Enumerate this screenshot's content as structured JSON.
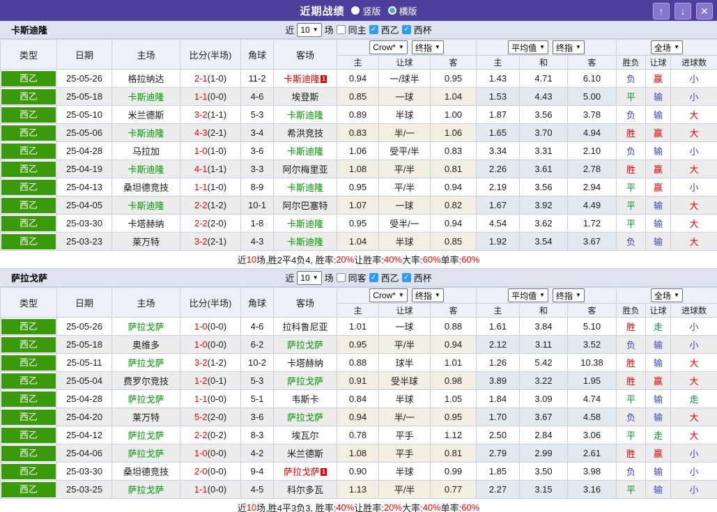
{
  "titlebar": {
    "title": "近期战绩",
    "radio_vertical": "竖版",
    "radio_horizontal": "横版",
    "selected_radio": "竖版",
    "up_icon": "↑",
    "down_icon": "↓",
    "close_icon": "✕"
  },
  "filter_labels": {
    "near": "近",
    "games": "场"
  },
  "table_header": {
    "type": "类型",
    "date": "日期",
    "home": "主场",
    "score": "比分(半场)",
    "corner": "角球",
    "away": "客场",
    "odds_source": "Crow*",
    "odds_final": "终指",
    "avg": "平均值",
    "avg_final": "终指",
    "fulltime": "全场",
    "sub_home": "主",
    "sub_handicap": "让球",
    "sub_away": "客",
    "sub_avg_home": "主",
    "sub_avg_draw": "和",
    "sub_avg_away": "客",
    "sub_result": "胜负",
    "sub_handicap_result": "让球",
    "sub_goals": "进球数"
  },
  "result_colors": {
    "r": "#e60000",
    "g": "#009933",
    "b": "#3b44c8"
  },
  "colors": {
    "titlebar_purple": "#4f3f9c",
    "titlebar_button": "#8577cd",
    "league_green": "#3a9a0c",
    "team_green": "#009900",
    "team_red": "#e60000",
    "score_red": "#ff0000",
    "filter_bg": "#dde4ef",
    "header_bg": "#ecf0f7",
    "odds_col_bg": "#fdf8ee",
    "avg_col_bg": "#e9f4f9",
    "checkbox_blue": "#2e9cf5"
  },
  "sections": [
    {
      "team": "卡斯迪隆",
      "filter": {
        "count": "10",
        "same_label": "同主",
        "same_checked": false,
        "league_label": "西乙",
        "league_checked": true,
        "cup_label": "西杯",
        "cup_checked": true
      },
      "rows": [
        {
          "lg": "西乙",
          "date": "25-05-26",
          "home": "格拉纳达",
          "homeType": "other",
          "away": "卡斯迪隆",
          "awayType": "red",
          "awayBadge": "1",
          "ft": "2-1",
          "ht": "(1-0)",
          "corner": "11-2",
          "oddsH": "0.94",
          "handicap": "一/球半",
          "oddsA": "0.95",
          "avgH": "1.43",
          "avgD": "4.71",
          "avgA": "6.10",
          "res": {
            "t": "负",
            "c": "b"
          },
          "hres": {
            "t": "赢",
            "c": "r"
          },
          "goals": {
            "t": "小",
            "c": "b"
          }
        },
        {
          "lg": "西乙",
          "date": "25-05-18",
          "home": "卡斯迪隆",
          "homeType": "self",
          "away": "埃登斯",
          "awayType": "other",
          "ft": "1-1",
          "ht": "(0-0)",
          "corner": "4-6",
          "oddsH": "0.85",
          "handicap": "一球",
          "oddsA": "1.04",
          "avgH": "1.53",
          "avgD": "4.43",
          "avgA": "5.00",
          "res": {
            "t": "平",
            "c": "g"
          },
          "hres": {
            "t": "输",
            "c": "b"
          },
          "goals": {
            "t": "小",
            "c": "b"
          }
        },
        {
          "lg": "西乙",
          "date": "25-05-10",
          "home": "米兰德斯",
          "homeType": "other",
          "away": "卡斯迪隆",
          "awayType": "self",
          "ft": "3-2",
          "ht": "(1-1)",
          "corner": "5-3",
          "oddsH": "0.89",
          "handicap": "半球",
          "oddsA": "1.00",
          "avgH": "1.87",
          "avgD": "3.56",
          "avgA": "3.78",
          "res": {
            "t": "负",
            "c": "b"
          },
          "hres": {
            "t": "输",
            "c": "b"
          },
          "goals": {
            "t": "大",
            "c": "r"
          }
        },
        {
          "lg": "西乙",
          "date": "25-05-06",
          "home": "卡斯迪隆",
          "homeType": "self",
          "away": "希洪竞技",
          "awayType": "other",
          "ft": "4-3",
          "ht": "(2-1)",
          "corner": "3-4",
          "oddsH": "0.83",
          "handicap": "半/一",
          "oddsA": "1.06",
          "avgH": "1.65",
          "avgD": "3.70",
          "avgA": "4.94",
          "res": {
            "t": "胜",
            "c": "r"
          },
          "hres": {
            "t": "赢",
            "c": "r"
          },
          "goals": {
            "t": "大",
            "c": "r"
          }
        },
        {
          "lg": "西乙",
          "date": "25-04-28",
          "home": "马拉加",
          "homeType": "other",
          "away": "卡斯迪隆",
          "awayType": "self",
          "ft": "1-0",
          "ht": "(1-0)",
          "corner": "3-6",
          "oddsH": "1.06",
          "handicap": "受平/半",
          "oddsA": "0.83",
          "avgH": "3.34",
          "avgD": "3.31",
          "avgA": "2.10",
          "res": {
            "t": "负",
            "c": "b"
          },
          "hres": {
            "t": "输",
            "c": "b"
          },
          "goals": {
            "t": "小",
            "c": "b"
          }
        },
        {
          "lg": "西乙",
          "date": "25-04-19",
          "home": "卡斯迪隆",
          "homeType": "self",
          "away": "阿尔梅里亚",
          "awayType": "other",
          "ft": "4-1",
          "ht": "(1-1)",
          "corner": "3-3",
          "oddsH": "1.08",
          "handicap": "平/半",
          "oddsA": "0.81",
          "avgH": "2.26",
          "avgD": "3.61",
          "avgA": "2.78",
          "res": {
            "t": "胜",
            "c": "r"
          },
          "hres": {
            "t": "赢",
            "c": "r"
          },
          "goals": {
            "t": "大",
            "c": "r"
          }
        },
        {
          "lg": "西乙",
          "date": "25-04-13",
          "home": "桑坦德竞技",
          "homeType": "other",
          "away": "卡斯迪隆",
          "awayType": "self",
          "ft": "1-1",
          "ht": "(1-0)",
          "corner": "8-9",
          "oddsH": "0.95",
          "handicap": "平/半",
          "oddsA": "0.94",
          "avgH": "2.19",
          "avgD": "3.56",
          "avgA": "2.94",
          "res": {
            "t": "平",
            "c": "g"
          },
          "hres": {
            "t": "赢",
            "c": "r"
          },
          "goals": {
            "t": "小",
            "c": "b"
          }
        },
        {
          "lg": "西乙",
          "date": "25-04-05",
          "home": "卡斯迪隆",
          "homeType": "self",
          "away": "阿尔巴塞特",
          "awayType": "other",
          "ft": "2-2",
          "ht": "(1-2)",
          "corner": "10-1",
          "oddsH": "1.07",
          "handicap": "一球",
          "oddsA": "0.82",
          "avgH": "1.67",
          "avgD": "3.92",
          "avgA": "4.49",
          "res": {
            "t": "平",
            "c": "g"
          },
          "hres": {
            "t": "输",
            "c": "b"
          },
          "goals": {
            "t": "大",
            "c": "r"
          }
        },
        {
          "lg": "西乙",
          "date": "25-03-30",
          "home": "卡塔赫纳",
          "homeType": "other",
          "away": "卡斯迪隆",
          "awayType": "self",
          "ft": "2-2",
          "ht": "(2-0)",
          "corner": "1-8",
          "oddsH": "0.95",
          "handicap": "受半/一",
          "oddsA": "0.94",
          "avgH": "4.54",
          "avgD": "3.62",
          "avgA": "1.72",
          "res": {
            "t": "平",
            "c": "g"
          },
          "hres": {
            "t": "输",
            "c": "b"
          },
          "goals": {
            "t": "大",
            "c": "r"
          }
        },
        {
          "lg": "西乙",
          "date": "25-03-23",
          "home": "莱万特",
          "homeType": "other",
          "away": "卡斯迪隆",
          "awayType": "self",
          "ft": "3-2",
          "ht": "(2-1)",
          "corner": "4-3",
          "oddsH": "1.04",
          "handicap": "半球",
          "oddsA": "0.85",
          "avgH": "1.92",
          "avgD": "3.54",
          "avgA": "3.67",
          "res": {
            "t": "负",
            "c": "b"
          },
          "hres": {
            "t": "输",
            "c": "b"
          },
          "goals": {
            "t": "大",
            "c": "r"
          }
        }
      ],
      "summary": [
        {
          "t": "近",
          "r": false
        },
        {
          "t": "10",
          "r": true
        },
        {
          "t": "场,胜2平4负4, 胜率:",
          "r": false
        },
        {
          "t": "20%",
          "r": true
        },
        {
          "t": " 让胜率:",
          "r": false
        },
        {
          "t": "40%",
          "r": true
        },
        {
          "t": " 大率:",
          "r": false
        },
        {
          "t": "60%",
          "r": true
        },
        {
          "t": " 单率:",
          "r": false
        },
        {
          "t": "60%",
          "r": true
        }
      ]
    },
    {
      "team": "萨拉戈萨",
      "filter": {
        "count": "10",
        "same_label": "同客",
        "same_checked": false,
        "league_label": "西乙",
        "league_checked": true,
        "cup_label": "西杯",
        "cup_checked": true
      },
      "rows": [
        {
          "lg": "西乙",
          "date": "25-05-26",
          "home": "萨拉戈萨",
          "homeType": "self",
          "away": "拉科鲁尼亚",
          "awayType": "other",
          "ft": "1-0",
          "ht": "(0-0)",
          "corner": "4-6",
          "oddsH": "1.01",
          "handicap": "一球",
          "oddsA": "0.88",
          "avgH": "1.61",
          "avgD": "3.84",
          "avgA": "5.10",
          "res": {
            "t": "胜",
            "c": "r"
          },
          "hres": {
            "t": "走",
            "c": "g"
          },
          "goals": {
            "t": "小",
            "c": "b"
          }
        },
        {
          "lg": "西乙",
          "date": "25-05-18",
          "home": "奥维多",
          "homeType": "other",
          "away": "萨拉戈萨",
          "awayType": "self",
          "ft": "1-0",
          "ht": "(0-0)",
          "corner": "6-2",
          "oddsH": "0.95",
          "handicap": "平/半",
          "oddsA": "0.94",
          "avgH": "2.12",
          "avgD": "3.11",
          "avgA": "3.52",
          "res": {
            "t": "负",
            "c": "b"
          },
          "hres": {
            "t": "输",
            "c": "b"
          },
          "goals": {
            "t": "小",
            "c": "b"
          }
        },
        {
          "lg": "西乙",
          "date": "25-05-11",
          "home": "萨拉戈萨",
          "homeType": "self",
          "away": "卡塔赫纳",
          "awayType": "other",
          "ft": "3-2",
          "ht": "(1-2)",
          "corner": "10-2",
          "oddsH": "0.88",
          "handicap": "球半",
          "oddsA": "1.01",
          "avgH": "1.26",
          "avgD": "5.42",
          "avgA": "10.38",
          "res": {
            "t": "胜",
            "c": "r"
          },
          "hres": {
            "t": "输",
            "c": "b"
          },
          "goals": {
            "t": "大",
            "c": "r"
          }
        },
        {
          "lg": "西乙",
          "date": "25-05-04",
          "home": "费罗尔竞技",
          "homeType": "other",
          "away": "萨拉戈萨",
          "awayType": "self",
          "ft": "1-2",
          "ht": "(0-1)",
          "corner": "5-3",
          "oddsH": "0.91",
          "handicap": "受半球",
          "oddsA": "0.98",
          "avgH": "3.89",
          "avgD": "3.22",
          "avgA": "1.95",
          "res": {
            "t": "胜",
            "c": "r"
          },
          "hres": {
            "t": "赢",
            "c": "r"
          },
          "goals": {
            "t": "大",
            "c": "r"
          }
        },
        {
          "lg": "西乙",
          "date": "25-04-28",
          "home": "萨拉戈萨",
          "homeType": "self",
          "away": "韦斯卡",
          "awayType": "other",
          "ft": "1-1",
          "ht": "(0-0)",
          "corner": "5-1",
          "oddsH": "0.84",
          "handicap": "半球",
          "oddsA": "1.05",
          "avgH": "1.84",
          "avgD": "3.09",
          "avgA": "4.74",
          "res": {
            "t": "平",
            "c": "g"
          },
          "hres": {
            "t": "输",
            "c": "b"
          },
          "goals": {
            "t": "走",
            "c": "g"
          }
        },
        {
          "lg": "西乙",
          "date": "25-04-20",
          "home": "莱万特",
          "homeType": "other",
          "away": "萨拉戈萨",
          "awayType": "self",
          "ft": "5-2",
          "ht": "(2-0)",
          "corner": "3-6",
          "oddsH": "0.94",
          "handicap": "半/一",
          "oddsA": "0.95",
          "avgH": "1.70",
          "avgD": "3.67",
          "avgA": "4.58",
          "res": {
            "t": "负",
            "c": "b"
          },
          "hres": {
            "t": "输",
            "c": "b"
          },
          "goals": {
            "t": "大",
            "c": "r"
          }
        },
        {
          "lg": "西乙",
          "date": "25-04-12",
          "home": "萨拉戈萨",
          "homeType": "self",
          "away": "埃瓦尔",
          "awayType": "other",
          "ft": "2-2",
          "ht": "(0-2)",
          "corner": "8-3",
          "oddsH": "0.78",
          "handicap": "平手",
          "oddsA": "1.12",
          "avgH": "2.50",
          "avgD": "2.84",
          "avgA": "3.06",
          "res": {
            "t": "平",
            "c": "g"
          },
          "hres": {
            "t": "走",
            "c": "g"
          },
          "goals": {
            "t": "大",
            "c": "r"
          }
        },
        {
          "lg": "西乙",
          "date": "25-04-06",
          "home": "萨拉戈萨",
          "homeType": "self",
          "away": "米兰德斯",
          "awayType": "other",
          "ft": "1-0",
          "ht": "(0-0)",
          "corner": "4-2",
          "oddsH": "1.08",
          "handicap": "平手",
          "oddsA": "0.81",
          "avgH": "2.79",
          "avgD": "2.99",
          "avgA": "2.61",
          "res": {
            "t": "胜",
            "c": "r"
          },
          "hres": {
            "t": "赢",
            "c": "r"
          },
          "goals": {
            "t": "小",
            "c": "b"
          }
        },
        {
          "lg": "西乙",
          "date": "25-03-30",
          "home": "桑坦德竞技",
          "homeType": "other",
          "away": "萨拉戈萨",
          "awayType": "red",
          "awayBadge": "1",
          "ft": "2-0",
          "ht": "(0-0)",
          "corner": "9-4",
          "oddsH": "0.90",
          "handicap": "半球",
          "oddsA": "0.99",
          "avgH": "1.85",
          "avgD": "3.50",
          "avgA": "3.98",
          "res": {
            "t": "负",
            "c": "b"
          },
          "hres": {
            "t": "输",
            "c": "b"
          },
          "goals": {
            "t": "小",
            "c": "b"
          }
        },
        {
          "lg": "西乙",
          "date": "25-03-25",
          "home": "萨拉戈萨",
          "homeType": "self",
          "away": "科尔多瓦",
          "awayType": "other",
          "ft": "1-1",
          "ht": "(0-0)",
          "corner": "4-5",
          "oddsH": "1.13",
          "handicap": "平/半",
          "oddsA": "0.77",
          "avgH": "2.27",
          "avgD": "3.15",
          "avgA": "3.16",
          "res": {
            "t": "平",
            "c": "g"
          },
          "hres": {
            "t": "输",
            "c": "b"
          },
          "goals": {
            "t": "小",
            "c": "b"
          }
        }
      ],
      "summary": [
        {
          "t": "近",
          "r": false
        },
        {
          "t": "10",
          "r": true
        },
        {
          "t": "场,胜4平3负3, 胜率:",
          "r": false
        },
        {
          "t": "40%",
          "r": true
        },
        {
          "t": " 让胜率:",
          "r": false
        },
        {
          "t": "20%",
          "r": true
        },
        {
          "t": " 大率:",
          "r": false
        },
        {
          "t": "40%",
          "r": true
        },
        {
          "t": " 单率:",
          "r": false
        },
        {
          "t": "60%",
          "r": true
        }
      ]
    }
  ]
}
